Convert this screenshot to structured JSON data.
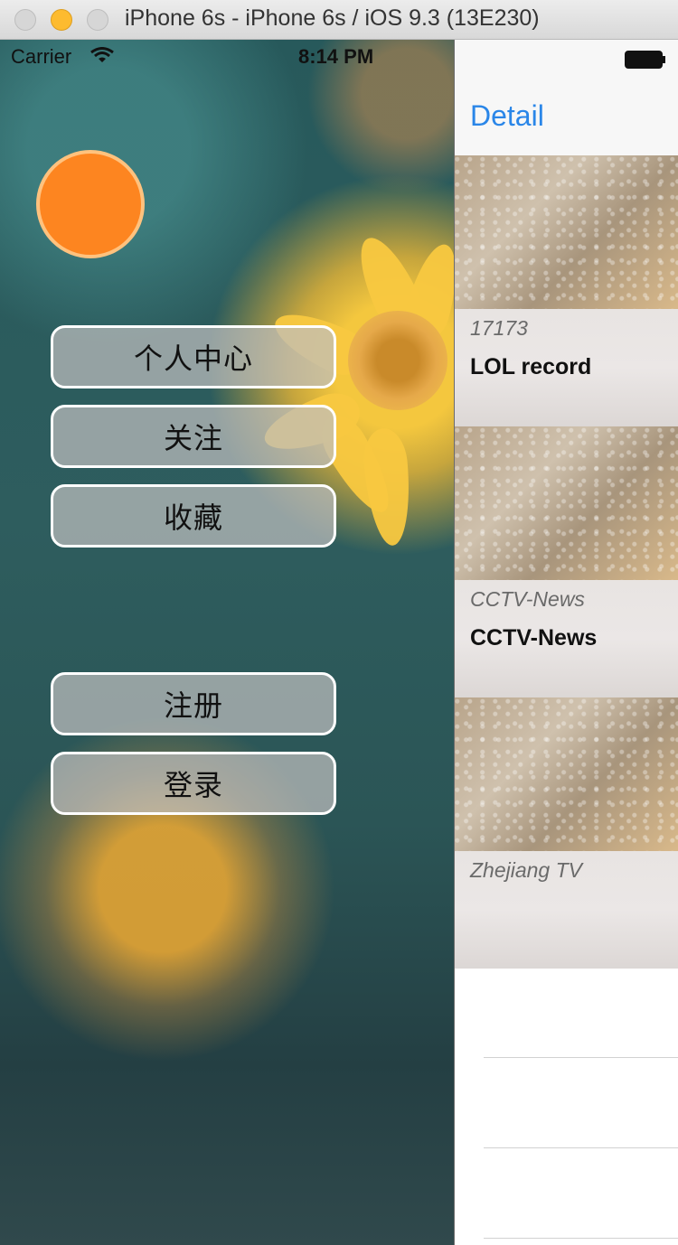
{
  "window": {
    "title": "iPhone 6s - iPhone 6s / iOS 9.3 (13E230)"
  },
  "status_bar": {
    "carrier": "Carrier",
    "time": "8:14 PM"
  },
  "colors": {
    "avatar": "#fd8520",
    "nav_accent": "#2a86e8"
  },
  "menu": {
    "top_buttons": [
      "个人中心",
      "关注",
      "收藏"
    ],
    "account_buttons": [
      "注册",
      "登录"
    ]
  },
  "detail": {
    "nav_title": "Detail",
    "items": [
      {
        "source": "17173",
        "title": "LOL record"
      },
      {
        "source": "CCTV-News",
        "title": "CCTV-News"
      },
      {
        "source": "Zhejiang TV",
        "title": ""
      }
    ]
  }
}
